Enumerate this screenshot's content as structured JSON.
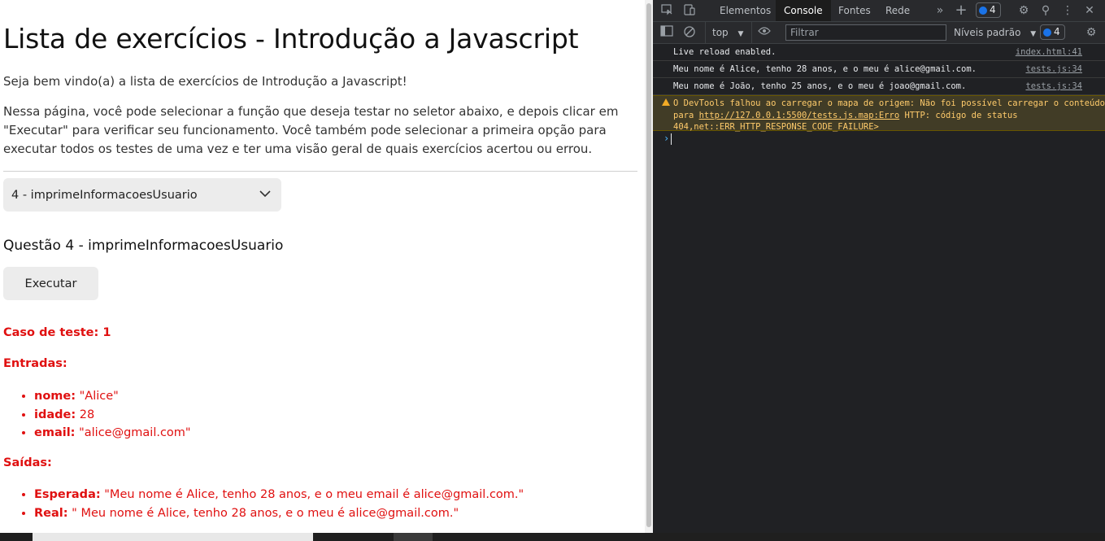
{
  "page": {
    "title": "Lista de exercícios - Introdução a Javascript",
    "intro1": "Seja bem vindo(a) a lista de exercícios de Introdução a Javascript!",
    "intro2": "Nessa página, você pode selecionar a função que deseja testar no seletor abaixo, e depois clicar em \"Executar\" para verificar seu funcionamento. Você também pode selecionar a primeira opção para executar todos os testes de uma vez e ter uma visão geral de quais exercícios acertou ou errou.",
    "select_value": "4 - imprimeInformacoesUsuario",
    "question_title": "Questão 4 - imprimeInformacoesUsuario",
    "execute_label": "Executar",
    "test_case": "Caso de teste: 1",
    "inputs_label": "Entradas:",
    "inputs": [
      {
        "key": "nome:",
        "value": " \"Alice\""
      },
      {
        "key": "idade:",
        "value": " 28"
      },
      {
        "key": "email:",
        "value": " \"alice@gmail.com\""
      }
    ],
    "outputs_label": "Saídas:",
    "outputs": [
      {
        "key": "Esperada:",
        "value": " \"Meu nome é Alice, tenho 28 anos, e o meu email é alice@gmail.com.\""
      },
      {
        "key": "Real:",
        "value": " \" Meu nome é Alice, tenho 28 anos, e o meu é alice@gmail.com.\""
      }
    ],
    "error_color": "#e01010"
  },
  "devtools": {
    "tabs": [
      "Elementos",
      "Console",
      "Fontes",
      "Rede"
    ],
    "active_tab": "Console",
    "issues_count": "4",
    "context": "top",
    "filter_placeholder": "Filtrar",
    "levels": "Níveis padrão",
    "toolbar_issues": "4",
    "logs": [
      {
        "text": "Live reload enabled.",
        "source": "index.html:41"
      },
      {
        "text": " Meu nome é Alice, tenho 28 anos, e o meu é alice@gmail.com.",
        "source": "tests.js:34"
      },
      {
        "text": " Meu nome é João, tenho 25 anos, e o meu é joao@gmail.com.",
        "source": "tests.js:34"
      }
    ],
    "warning": {
      "text_before": "O DevTools falhou ao carregar o mapa de origem: Não foi possível carregar o conteúdo para ",
      "link": "http://127.0.0.1:5500/tests.js.map:Erro",
      "text_after": " HTTP: código de status 404,net::ERR_HTTP_RESPONSE_CODE_FAILURE>"
    },
    "prompt": "›"
  }
}
